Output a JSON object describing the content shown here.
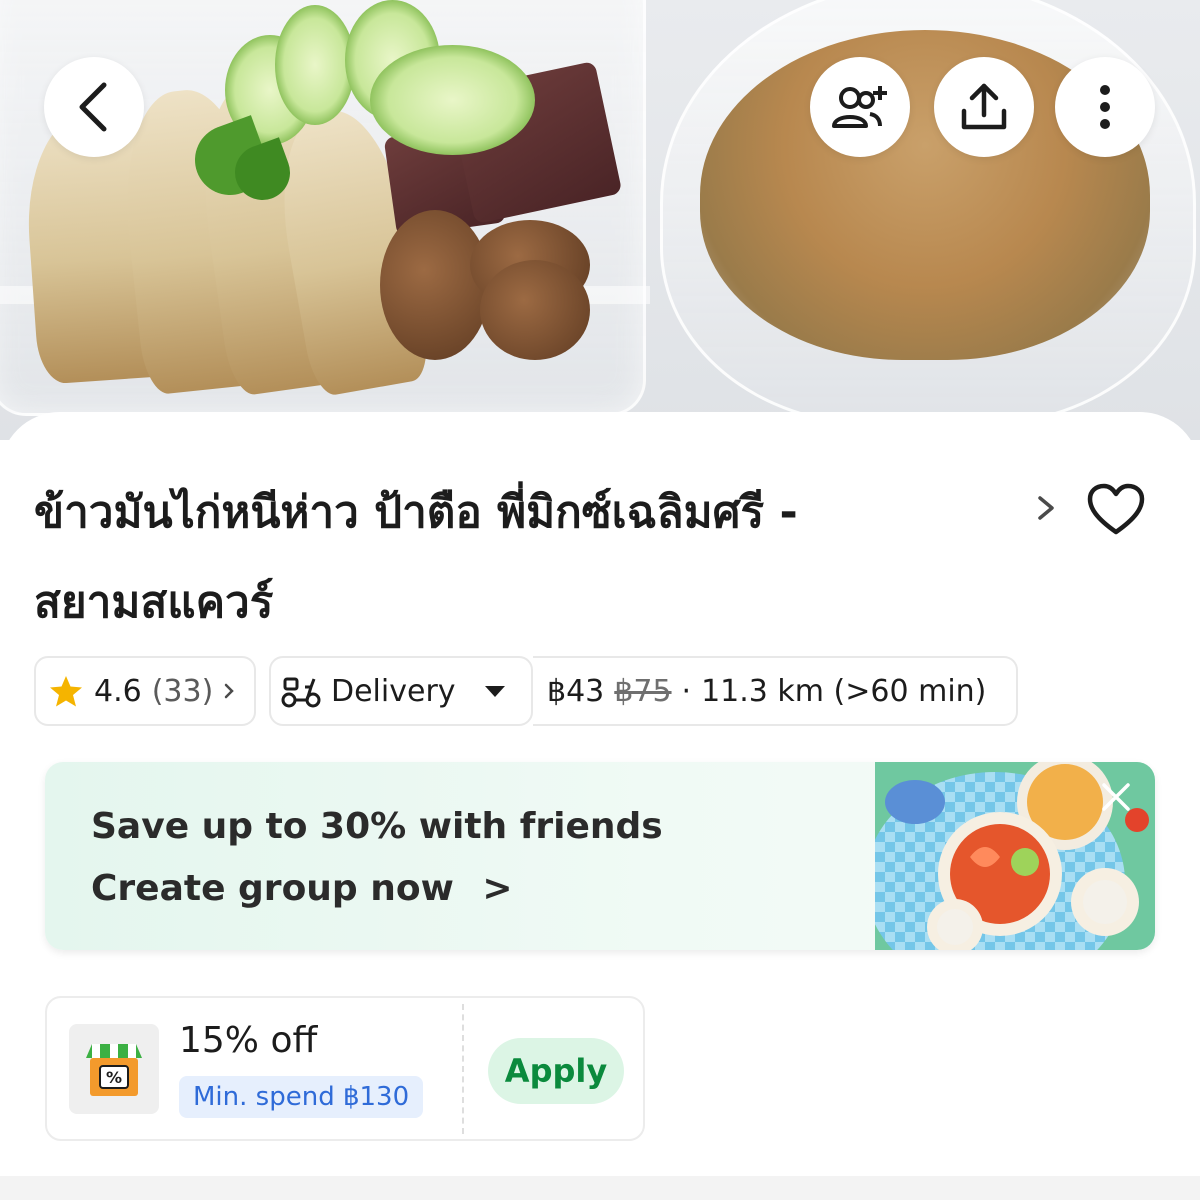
{
  "header": {
    "back_icon": "chevron-left-icon",
    "actions": [
      "add-group-icon",
      "share-icon",
      "more-vertical-icon"
    ]
  },
  "restaurant": {
    "name": "ข้าวมันไก่หนีห่าว ป้าตือ พี่มิกซ์เฉลิมศรี - สยามสแควร์",
    "favorite_icon": "heart-outline-icon"
  },
  "info_chips": {
    "rating": "4.6",
    "rating_count": "(33)",
    "delivery_mode": "Delivery",
    "delivery_fee": "฿43",
    "original_fee": "฿75",
    "separator": "·",
    "distance_time": "11.3 km (>60 min)"
  },
  "group_promo": {
    "line1": "Save up to 30% with friends",
    "line2": "Create group now",
    "line2_arrow": ">"
  },
  "voucher": {
    "title": "15% off",
    "min_spend": "Min. spend ฿130",
    "apply_label": "Apply",
    "icon": "shop-discount-icon"
  },
  "colors": {
    "accent_green": "#0b8a3d",
    "apply_bg": "#dcf5e5",
    "min_spend_text": "#2f6bd8",
    "star": "#f5b400",
    "promo_bg": "#e4f6ee"
  }
}
